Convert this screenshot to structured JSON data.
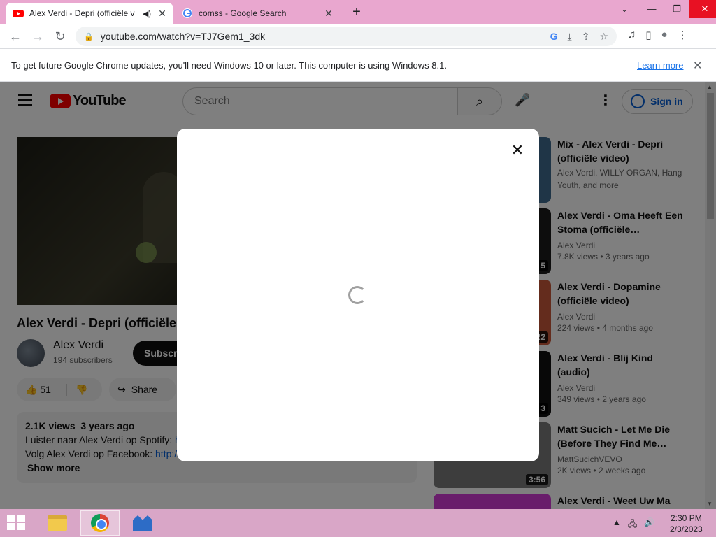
{
  "browser": {
    "tabs": [
      {
        "title": "Alex Verdi - Depri (officiële v",
        "audio": "◀)",
        "close": "✕"
      },
      {
        "title": "comss - Google Search",
        "close": "✕"
      }
    ],
    "new_tab": "+",
    "tabs_menu": "⌄",
    "window": {
      "minimize": "—",
      "restore": "❐",
      "close": "✕"
    },
    "nav": {
      "back": "←",
      "forward": "→",
      "reload": "↻"
    },
    "url": "youtube.com/watch?v=TJ7Gem1_3dk",
    "omni_icons": {
      "google": "G",
      "install": "⤓",
      "share": "⇪",
      "bookmark": "☆"
    },
    "toolbar_icons": {
      "media": "♫",
      "sidepanel": "▯",
      "profile": "●",
      "menu": "⋮"
    }
  },
  "infobar": {
    "message": "To get future Google Chrome updates, you'll need Windows 10 or later. This computer is using Windows 8.1.",
    "link": "Learn more",
    "close": "✕"
  },
  "youtube": {
    "logo": "YouTube",
    "search_placeholder": "Search",
    "search_icon": "⌕",
    "mic_icon": "🎤",
    "more_icon": "⋮",
    "sign_in": "Sign in",
    "video": {
      "title": "Alex Verdi - Depri (officiële video)",
      "channel": "Alex Verdi",
      "subscribers": "194 subscribers",
      "subscribe": "Subscribe",
      "likes": "51",
      "like_icon": "👍",
      "dislike_icon": "👎",
      "share": "Share",
      "share_icon": "↪",
      "views": "2.1K views",
      "age": "3 years ago",
      "desc_line1": "Luister naar Alex Verdi op Spotify: ",
      "desc_link1": "h",
      "desc_line2": "Volg Alex Verdi op Facebook: ",
      "desc_link2": "http://",
      "show_more": "Show more"
    },
    "recommendations": [
      {
        "title": "Mix - Alex Verdi - Depri (officiële video)",
        "channel": "Alex Verdi, WILLY ORGAN, Hang Youth, and more",
        "views": "",
        "age": "",
        "duration": "",
        "color": "#3f6b8e"
      },
      {
        "title": "Alex Verdi - Oma Heeft Een Stoma (officiële…",
        "channel": "Alex Verdi",
        "views": "7.8K views",
        "age": "3 years ago",
        "duration": "5",
        "color": "#1a1a1a"
      },
      {
        "title": "Alex Verdi - Dopamine (officiële video)",
        "channel": "Alex Verdi",
        "views": "224 views",
        "age": "4 months ago",
        "duration": "22",
        "color": "#c9583a"
      },
      {
        "title": "Alex Verdi - Blij Kind (audio)",
        "channel": "Alex Verdi",
        "views": "349 views",
        "age": "2 years ago",
        "duration": "3",
        "color": "#111111"
      },
      {
        "title": "Matt Sucich - Let Me Die (Before They Find Me…",
        "channel": "MattSucichVEVO",
        "views": "2K views",
        "age": "2 weeks ago",
        "duration": "3:56",
        "color": "#7a7a7a"
      },
      {
        "title": "Alex Verdi - Weet Uw Ma",
        "channel": "",
        "views": "",
        "age": "",
        "duration": "",
        "color": "#d23bd6"
      }
    ]
  },
  "modal": {
    "close": "✕"
  },
  "taskbar": {
    "time": "2:30 PM",
    "date": "2/3/2023",
    "tray": {
      "arrow": "▲",
      "network": "🖧",
      "volume": "🔊"
    }
  }
}
